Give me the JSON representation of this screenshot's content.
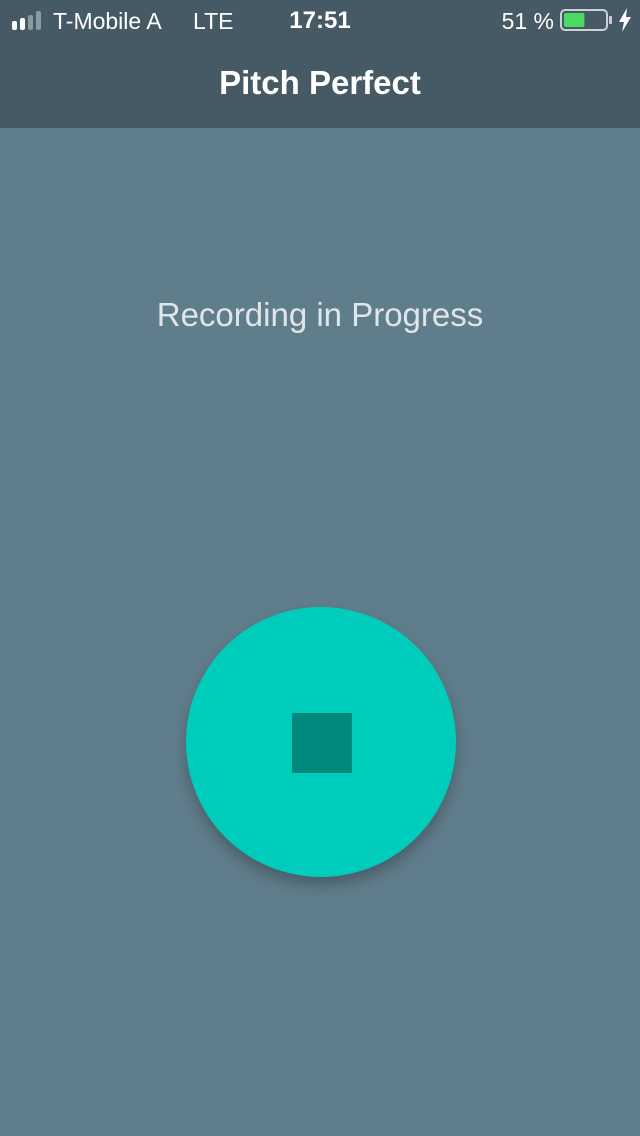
{
  "status_bar": {
    "carrier": "T-Mobile A",
    "network": "LTE",
    "time": "17:51",
    "battery_percent_label": "51 %",
    "battery_level": 0.51,
    "signal_bars": 2,
    "icons": [
      "signal-icon",
      "battery-icon",
      "charging-bolt-icon"
    ]
  },
  "nav": {
    "title": "Pitch Perfect"
  },
  "main": {
    "recording_label": "Recording in Progress",
    "stop_button_icon": "stop-icon"
  },
  "colors": {
    "nav_background": "#455a64",
    "screen_background": "#607d8b",
    "button_accent": "#00ccbb",
    "stop_icon": "#00897b",
    "battery_fill": "#4cd964"
  }
}
